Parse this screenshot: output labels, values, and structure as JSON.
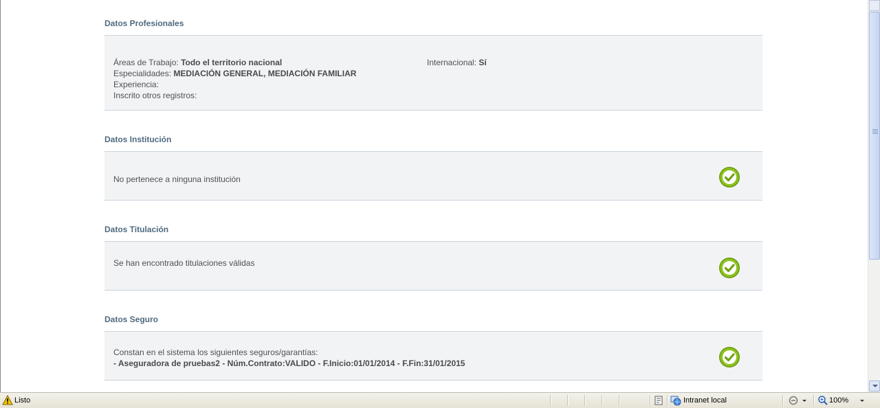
{
  "sections": {
    "profesionales": {
      "title": "Datos Profesionales",
      "areas_label": "Áreas de Trabajo:",
      "areas_value": "Todo el territorio nacional",
      "internacional_label": "Internacional:",
      "internacional_value": "Sí",
      "especialidades_label": "Especialidades:",
      "especialidades_value": "MEDIACIÓN GENERAL, MEDIACIÓN FAMILIAR",
      "experiencia_label": "Experiencia:",
      "inscrito_label": "Inscrito otros registros:"
    },
    "institucion": {
      "title": "Datos Institución",
      "text": "No pertenece a ninguna institución"
    },
    "titulacion": {
      "title": "Datos Titulación",
      "text": "Se han encontrado titulaciones válidas"
    },
    "seguro": {
      "title": "Datos Seguro",
      "intro": "Constan en el sistema los siguientes seguros/garantías:",
      "policy": "- Aseguradora de pruebas2 - Núm.Contrato:VALIDO - F.Inicio:01/01/2014 - F.Fin:31/01/2015"
    }
  },
  "status_bar": {
    "status_text": "Listo",
    "zone_text": "Intranet local",
    "zoom_text": "100%"
  },
  "colors": {
    "section_title": "#4f6a80",
    "panel_bg": "#f2f3f5",
    "panel_border": "#c9d3dc",
    "check_green": "#8dc21f"
  },
  "icons": {
    "check": "check-circle-icon",
    "warning": "warning-icon",
    "zone": "globe-network-icon",
    "zoom": "magnifier-icon"
  }
}
